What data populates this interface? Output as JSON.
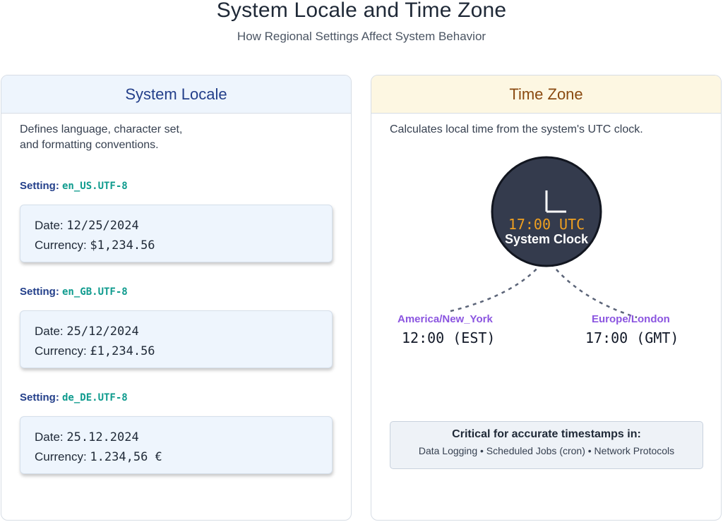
{
  "title": "System Locale and Time Zone",
  "subtitle": "How Regional Settings Affect System Behavior",
  "locale_panel": {
    "heading": "System Locale",
    "description_line1": "Defines language, character set,",
    "description_line2": "and formatting conventions.",
    "setting_prefix": "Setting:",
    "date_prefix": "Date:",
    "currency_prefix": "Currency:",
    "settings": [
      {
        "name": "en_US.UTF-8",
        "date": "12/25/2024",
        "currency": "$1,234.56"
      },
      {
        "name": "en_GB.UTF-8",
        "date": "25/12/2024",
        "currency": "£1,234.56"
      },
      {
        "name": "de_DE.UTF-8",
        "date": "25.12.2024",
        "currency": "1.234,56 €"
      }
    ]
  },
  "timezone_panel": {
    "heading": "Time Zone",
    "description": "Calculates local time from the system's UTC clock.",
    "clock": {
      "time": "17:00 UTC",
      "label": "System Clock"
    },
    "zones": [
      {
        "name": "America/New_York",
        "time": "12:00 (EST)"
      },
      {
        "name": "Europe/London",
        "time": "17:00 (GMT)"
      }
    ],
    "note": {
      "title": "Critical for accurate timestamps in:",
      "body": "Data Logging • Scheduled Jobs (cron) • Network Protocols"
    }
  },
  "colors": {
    "locale_accent": "#233f8a",
    "timezone_accent": "#8a4a10",
    "setting_value": "#0f9b8e",
    "zone_label": "#8b55e0",
    "clock_face": "#343b4d",
    "clock_time": "#f0a020"
  }
}
